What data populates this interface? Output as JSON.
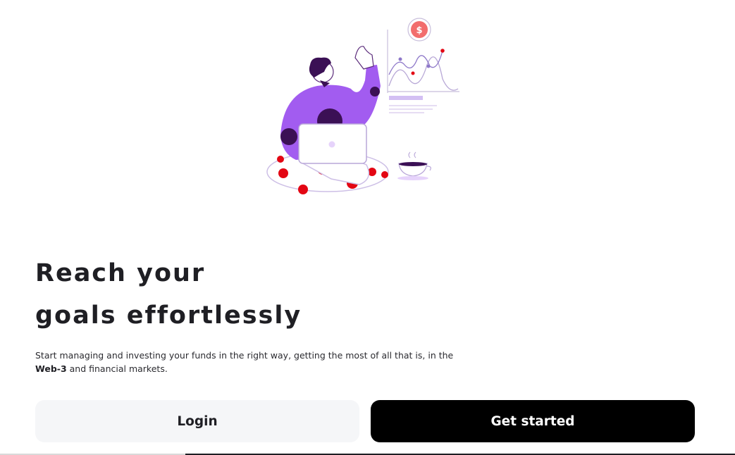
{
  "hero": {
    "illustration": "person-with-laptop-and-chart-icon"
  },
  "headline": {
    "line1": "Reach your",
    "line2": "goals effortlessly"
  },
  "subtitle": {
    "part1": "Start managing and investing your funds in the right way, getting the most of all that is, in the",
    "bold": "Web-3",
    "part2": "and financial markets."
  },
  "buttons": {
    "login": "Login",
    "get_started": "Get started"
  },
  "colors": {
    "accent_purple": "#a25cf0",
    "accent_red": "#e30613",
    "primary_button": "#000000",
    "secondary_button": "#f5f6f8"
  }
}
